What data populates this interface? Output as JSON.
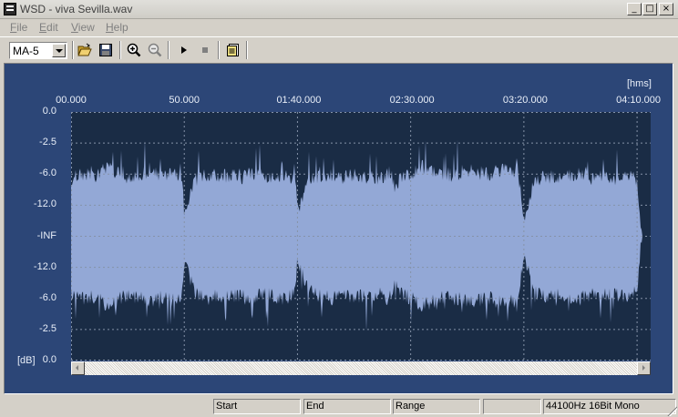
{
  "window": {
    "title": "WSD - viva Sevilla.wav",
    "minimize_label": "_",
    "maximize_label": "□",
    "close_label": "×"
  },
  "menu": {
    "items": [
      {
        "label": "File",
        "mnemonic": "F"
      },
      {
        "label": "Edit",
        "mnemonic": "E"
      },
      {
        "label": "View",
        "mnemonic": "V"
      },
      {
        "label": "Help",
        "mnemonic": "H"
      }
    ]
  },
  "toolbar": {
    "preset_value": "MA-5",
    "buttons": [
      "open-folder-icon",
      "save-icon",
      "zoom-in-icon",
      "zoom-out-icon",
      "play-icon",
      "stop-icon",
      "document-icon"
    ]
  },
  "chart_data": {
    "type": "area",
    "x_unit_label": "[hms]",
    "y_unit_label": "[dB]",
    "x_tick_labels": [
      "00.000",
      "50.000",
      "01:40.000",
      "02:30.000",
      "03:20.000",
      "04:10.000"
    ],
    "x_tick_seconds": [
      0,
      50,
      100,
      150,
      200,
      250
    ],
    "y_tick_labels": [
      "0.0",
      "-2.5",
      "-6.0",
      "-12.0",
      "-INF",
      "-12.0",
      "-6.0",
      "-2.5",
      "0.0"
    ],
    "y_tick_amplitude": [
      1,
      0.75,
      0.5,
      0.25,
      0,
      -0.25,
      -0.5,
      -0.75,
      -1
    ],
    "xlim_seconds": [
      0,
      256
    ],
    "grid": true,
    "waveform_envelope": {
      "description": "mono signal envelope",
      "t_seconds": [
        0,
        5,
        10,
        15,
        20,
        25,
        30,
        35,
        40,
        45,
        49,
        50,
        55,
        60,
        65,
        70,
        75,
        80,
        85,
        90,
        95,
        99,
        100,
        105,
        110,
        115,
        120,
        125,
        130,
        135,
        140,
        143,
        145,
        150,
        155,
        160,
        165,
        170,
        175,
        180,
        185,
        190,
        195,
        197,
        200,
        205,
        210,
        215,
        220,
        225,
        230,
        235,
        240,
        245,
        248,
        250,
        252,
        256
      ],
      "peak_amplitude": [
        0.46,
        0.5,
        0.48,
        0.55,
        0.52,
        0.47,
        0.5,
        0.53,
        0.49,
        0.51,
        0.46,
        0.2,
        0.46,
        0.5,
        0.48,
        0.49,
        0.47,
        0.5,
        0.46,
        0.49,
        0.5,
        0.45,
        0.2,
        0.44,
        0.48,
        0.5,
        0.47,
        0.49,
        0.48,
        0.46,
        0.5,
        0.4,
        0.45,
        0.5,
        0.56,
        0.52,
        0.49,
        0.5,
        0.53,
        0.51,
        0.5,
        0.54,
        0.5,
        0.58,
        0.15,
        0.46,
        0.48,
        0.47,
        0.49,
        0.5,
        0.47,
        0.48,
        0.46,
        0.5,
        0.47,
        0.44,
        0,
        0
      ]
    },
    "colors": {
      "background": "#1a2c45",
      "waveform": "#93a8d6",
      "grid": "#8592a8",
      "frame": "#2c4677"
    }
  },
  "status": {
    "start_label": "Start",
    "end_label": "End",
    "range_label": "Range",
    "empty_label": "",
    "format_label": "44100Hz 16Bit Mono"
  }
}
